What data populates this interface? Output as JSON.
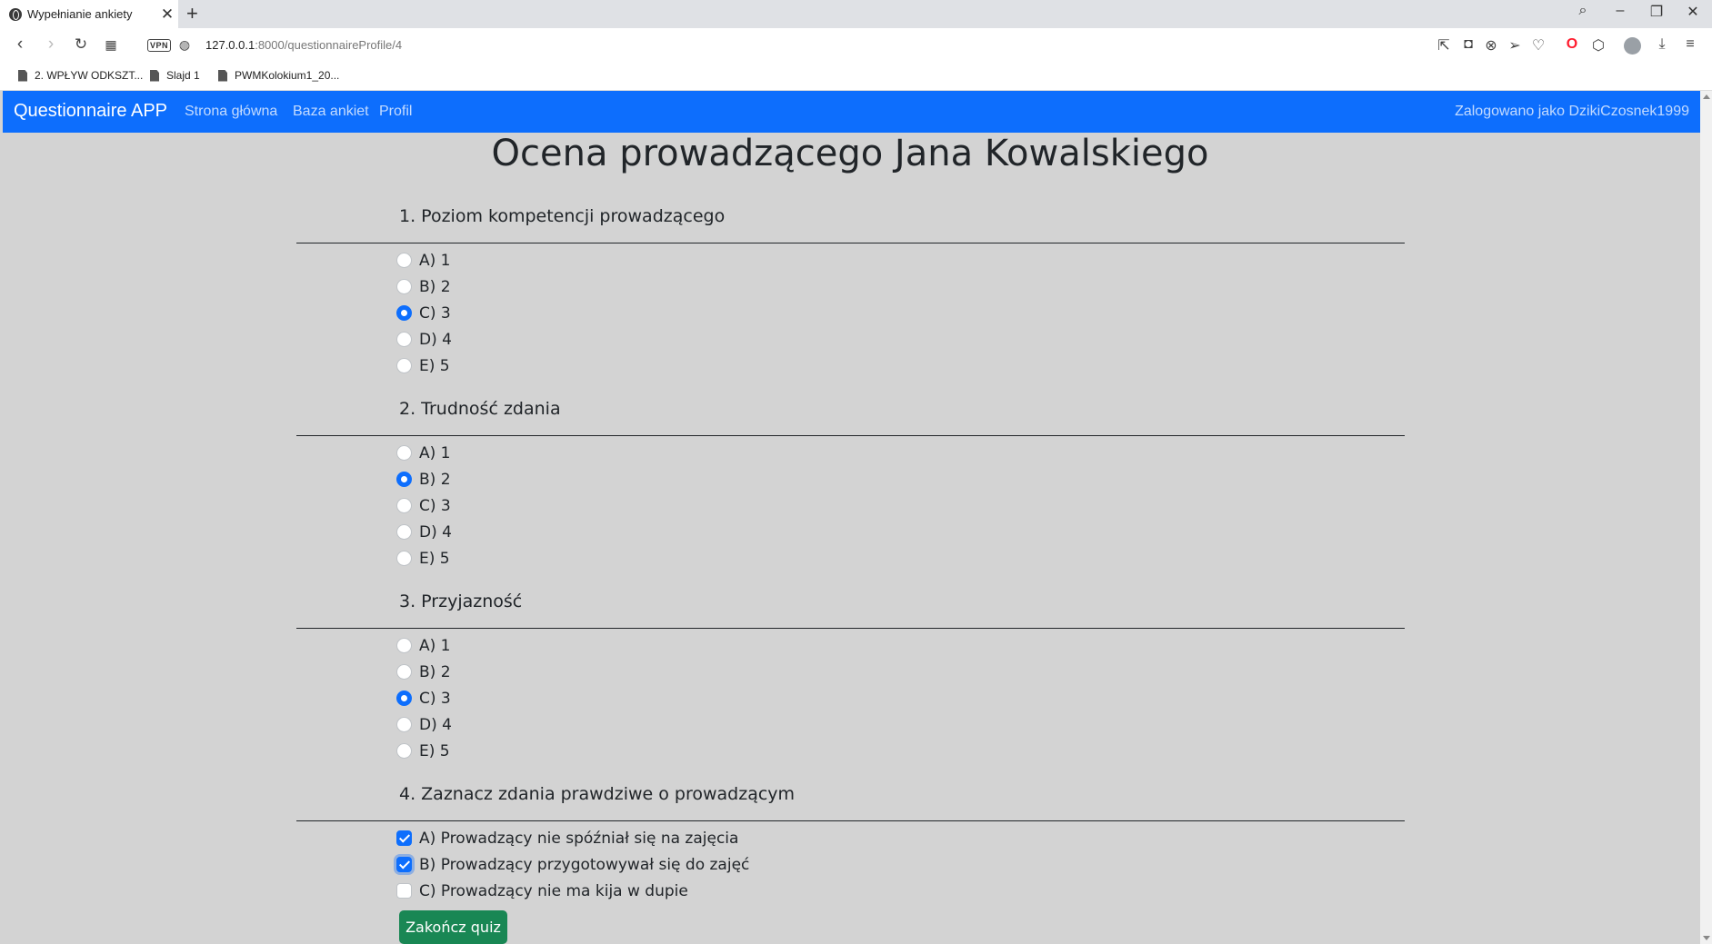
{
  "browser": {
    "tab_title": "Wypełnianie ankiety",
    "tab_close": "✕",
    "new_tab": "+",
    "url_host": "127.0.0.1",
    "url_path": ":8000/questionnaireProfile/4",
    "vpn_label": "VPN",
    "bookmarks": [
      {
        "label": "2. WPŁYW ODKSZT..."
      },
      {
        "label": "Slajd 1"
      },
      {
        "label": "PWMKolokium1_20..."
      }
    ]
  },
  "navbar": {
    "brand": "Questionnaire APP",
    "links": [
      {
        "label": "Strona główna"
      },
      {
        "label": "Baza ankiet"
      },
      {
        "label": "Profil"
      }
    ],
    "user_text": "Zalogowano jako DzikiCzosnek1999",
    "color": "#0d6efd"
  },
  "page": {
    "title": "Ocena prowadzącego Jana Kowalskiego"
  },
  "questions": [
    {
      "title": "1. Poziom kompetencji prowadzącego",
      "type": "radio",
      "options": [
        {
          "label": "A) 1",
          "checked": false
        },
        {
          "label": "B) 2",
          "checked": false
        },
        {
          "label": "C) 3",
          "checked": true
        },
        {
          "label": "D) 4",
          "checked": false
        },
        {
          "label": "E) 5",
          "checked": false
        }
      ]
    },
    {
      "title": "2. Trudność zdania",
      "type": "radio",
      "options": [
        {
          "label": "A) 1",
          "checked": false
        },
        {
          "label": "B) 2",
          "checked": true
        },
        {
          "label": "C) 3",
          "checked": false
        },
        {
          "label": "D) 4",
          "checked": false
        },
        {
          "label": "E) 5",
          "checked": false
        }
      ]
    },
    {
      "title": "3. Przyjazność",
      "type": "radio",
      "options": [
        {
          "label": "A) 1",
          "checked": false
        },
        {
          "label": "B) 2",
          "checked": false
        },
        {
          "label": "C) 3",
          "checked": true
        },
        {
          "label": "D) 4",
          "checked": false
        },
        {
          "label": "E) 5",
          "checked": false
        }
      ]
    },
    {
      "title": "4. Zaznacz zdania prawdziwe o prowadzącym",
      "type": "checkbox",
      "options": [
        {
          "label": "A) Prowadzący nie spóźniał się na zajęcia",
          "checked": true
        },
        {
          "label": "B) Prowadzący przygotowywał się do zajęć",
          "checked": true
        },
        {
          "label": "C) Prowadzący nie ma kija w dupie",
          "checked": false
        }
      ]
    }
  ],
  "submit": {
    "label": "Zakończ quiz",
    "color": "#198754"
  }
}
